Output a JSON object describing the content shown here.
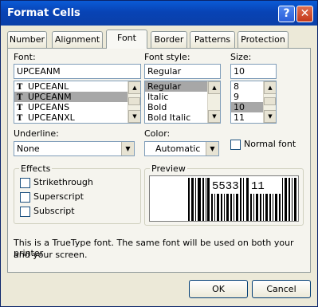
{
  "window": {
    "title": "Format Cells",
    "help_glyph": "?",
    "close_glyph": "✕"
  },
  "tabs": [
    {
      "label": "Number"
    },
    {
      "label": "Alignment"
    },
    {
      "label": "Font"
    },
    {
      "label": "Border"
    },
    {
      "label": "Patterns"
    },
    {
      "label": "Protection"
    }
  ],
  "font": {
    "label": "Font:",
    "value": "UPCEANM",
    "items": [
      {
        "label": "UPCEANL",
        "icon": "truetype-icon"
      },
      {
        "label": "UPCEANM",
        "icon": "truetype-icon",
        "selected": true
      },
      {
        "label": "UPCEANS",
        "icon": "truetype-icon"
      },
      {
        "label": "UPCEANXL",
        "icon": "truetype-icon"
      }
    ],
    "tt_glyph": "T"
  },
  "font_style": {
    "label": "Font style:",
    "value": "Regular",
    "items": [
      {
        "label": "Regular",
        "selected": true
      },
      {
        "label": "Italic"
      },
      {
        "label": "Bold"
      },
      {
        "label": "Bold Italic"
      }
    ]
  },
  "size": {
    "label": "Size:",
    "value": "10",
    "items": [
      {
        "label": "8"
      },
      {
        "label": "9"
      },
      {
        "label": "10",
        "selected": true
      },
      {
        "label": "11"
      }
    ]
  },
  "underline": {
    "label": "Underline:",
    "value": "None"
  },
  "color": {
    "label": "Color:",
    "value": "Automatic",
    "swatch": "#000000"
  },
  "normal_font": {
    "label": "Normal font",
    "checked": false
  },
  "effects": {
    "label": "Effects",
    "items": [
      {
        "label": "Strikethrough",
        "checked": false
      },
      {
        "label": "Superscript",
        "checked": false
      },
      {
        "label": "Subscript",
        "checked": false
      }
    ]
  },
  "preview": {
    "label": "Preview",
    "digits_left": "5533",
    "digits_right": "11"
  },
  "note": {
    "line1": "This is a TrueType font.  The same font will be used on both your printer",
    "line2": "and your screen."
  },
  "buttons": {
    "ok": "OK",
    "cancel": "Cancel"
  },
  "colors": {
    "title_bar": "#0a4bc6",
    "selection": "#a7a7a7",
    "dialog_bg": "#ece9d8"
  }
}
